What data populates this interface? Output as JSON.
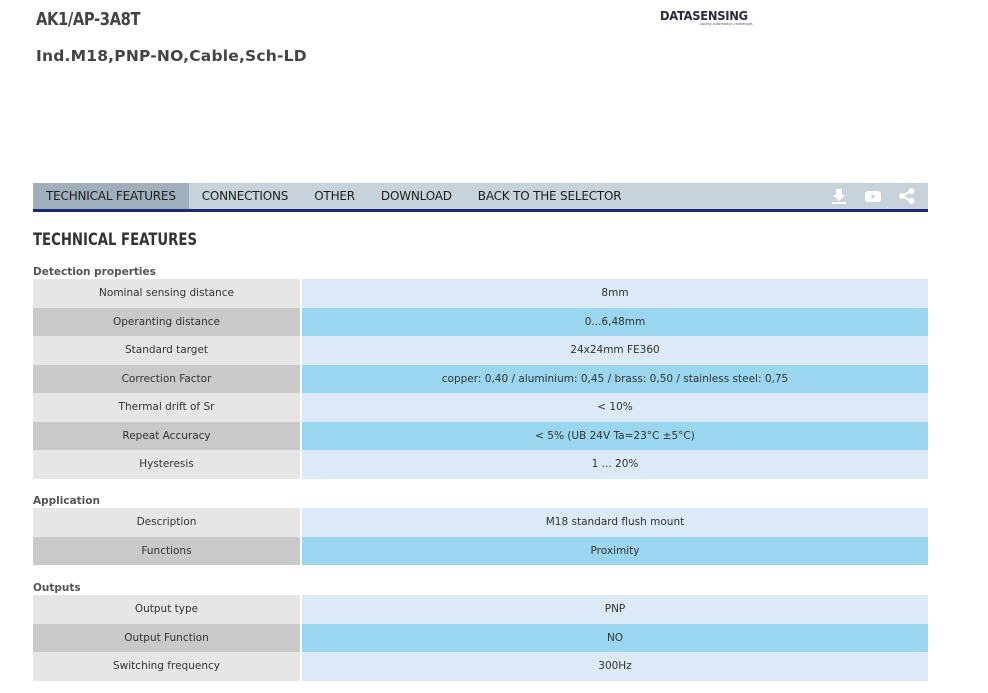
{
  "header": {
    "product_code": "AK1/AP-3A8T",
    "product_description": "Ind.M18,PNP-NO,Cable,Sch-LD",
    "logo": {
      "text": "DATASENSING",
      "tagline": "saving automation challenges"
    }
  },
  "tabs": [
    {
      "label": "TECHNICAL FEATURES",
      "active": true
    },
    {
      "label": "CONNECTIONS",
      "active": false
    },
    {
      "label": "OTHER",
      "active": false
    },
    {
      "label": "DOWNLOAD",
      "active": false
    },
    {
      "label": "BACK TO THE SELECTOR",
      "active": false
    }
  ],
  "tab_icons": [
    "download-icon",
    "youtube-icon",
    "share-icon"
  ],
  "section_title": "TECHNICAL FEATURES",
  "groups": [
    {
      "title": "Detection properties",
      "rows": [
        {
          "label": "Nominal sensing distance",
          "value": "8mm"
        },
        {
          "label": "Operanting distance",
          "value": "0...6,48mm"
        },
        {
          "label": "Standard target",
          "value": "24x24mm FE360"
        },
        {
          "label": "Correction Factor",
          "value": "copper: 0,40 / aluminium: 0,45 / brass: 0,50 / stainless steel: 0,75"
        },
        {
          "label": "Thermal drift of Sr",
          "value": "< 10%"
        },
        {
          "label": "Repeat Accuracy",
          "value": "< 5% (UB 24V Ta=23°C ±5°C)"
        },
        {
          "label": "Hysteresis",
          "value": "1 ... 20%"
        }
      ]
    },
    {
      "title": "Application",
      "rows": [
        {
          "label": "Description",
          "value": "M18 standard flush mount"
        },
        {
          "label": "Functions",
          "value": "Proximity"
        }
      ]
    },
    {
      "title": "Outputs",
      "rows": [
        {
          "label": "Output type",
          "value": "PNP"
        },
        {
          "label": "Output Function",
          "value": "NO"
        },
        {
          "label": "Switching frequency",
          "value": "300Hz"
        }
      ]
    }
  ],
  "colors": {
    "tabbar_bg": "#c7d2da",
    "tab_active_bg": "#9fb0bc",
    "tabbar_border": "#1b2a73",
    "row_label_light": "#e6e6e6",
    "row_label_dark": "#c9c9c9",
    "row_value_light": "#dce9f6",
    "row_value_dark": "#9ad6f0"
  }
}
